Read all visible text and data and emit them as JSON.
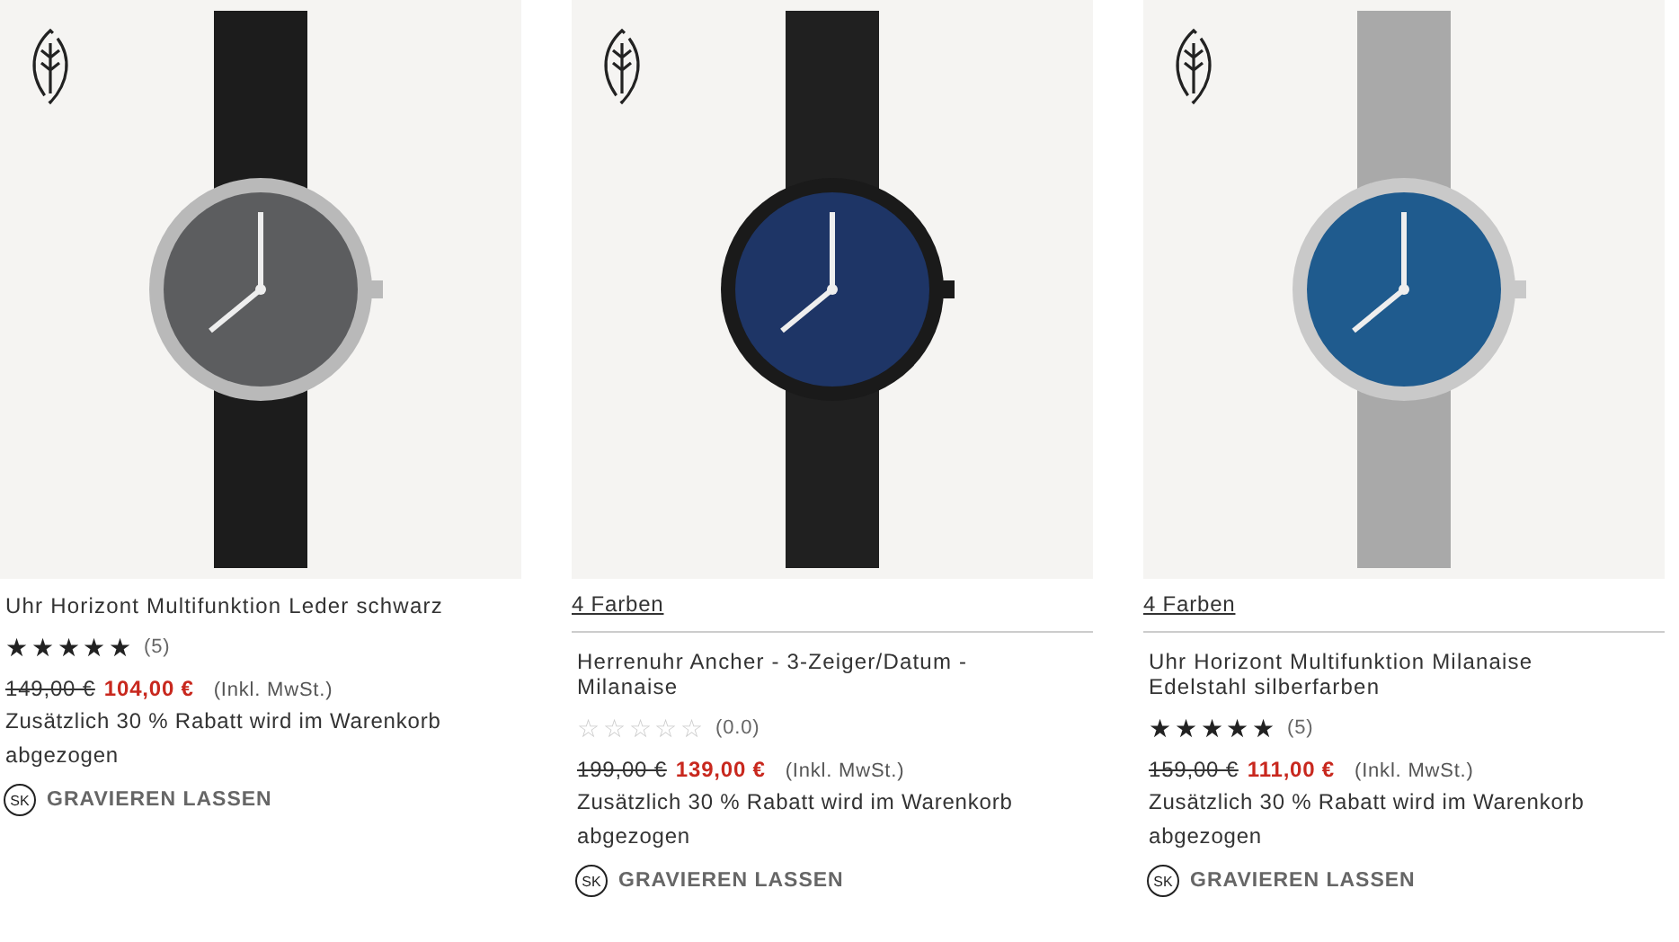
{
  "products": [
    {
      "eco_badge": true,
      "title": "Uhr Horizont Multifunktion Leder schwarz",
      "stars": 5,
      "review_count": "(5)",
      "old_price": "149,00 €",
      "price": "104,00 €",
      "tax_note": "(Inkl. MwSt.)",
      "discount_note": "Zusätzlich 30 % Rabatt wird im Warenkorb abgezogen",
      "engrave_badge": "SK",
      "engrave_label": "GRAVIEREN LASSEN"
    },
    {
      "eco_badge": true,
      "colors_link": "4 Farben",
      "title": "Herrenuhr Ancher - 3-Zeiger/Datum - Milanaise",
      "stars": 0,
      "review_count": "(0.0)",
      "old_price": "199,00 €",
      "price": "139,00 €",
      "tax_note": "(Inkl. MwSt.)",
      "discount_note": "Zusätzlich 30 % Rabatt wird im Warenkorb abgezogen",
      "engrave_badge": "SK",
      "engrave_label": "GRAVIEREN LASSEN"
    },
    {
      "eco_badge": true,
      "colors_link": "4 Farben",
      "title": "Uhr Horizont Multifunktion Milanaise Edelstahl silberfarben",
      "stars": 5,
      "review_count": "(5)",
      "old_price": "159,00 €",
      "price": "111,00 €",
      "tax_note": "(Inkl. MwSt.)",
      "discount_note": "Zusätzlich 30 % Rabatt wird im Warenkorb abgezogen",
      "engrave_badge": "SK",
      "engrave_label": "GRAVIEREN LASSEN"
    }
  ]
}
